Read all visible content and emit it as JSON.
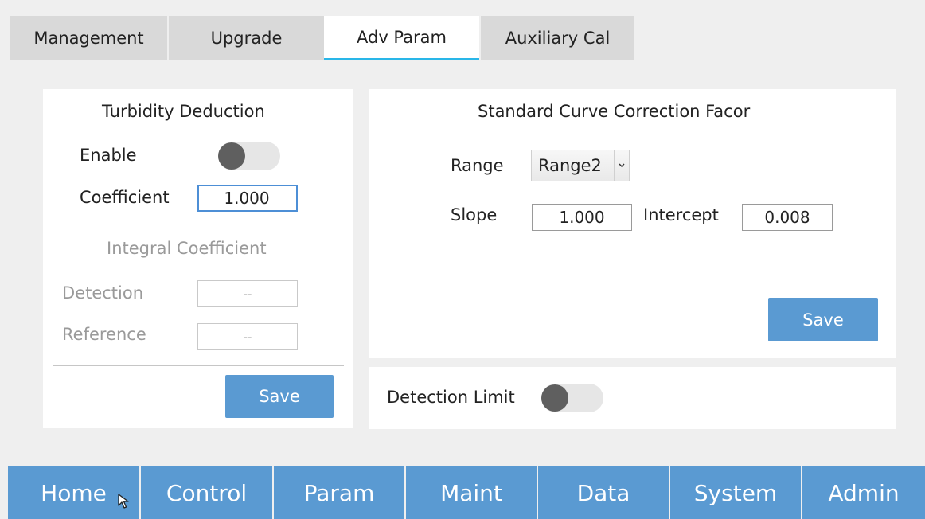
{
  "tabs": [
    {
      "label": "Management",
      "active": false
    },
    {
      "label": "Upgrade",
      "active": false
    },
    {
      "label": "Adv Param",
      "active": true
    },
    {
      "label": "Auxiliary Cal",
      "active": false
    }
  ],
  "turbidity": {
    "title": "Turbidity Deduction",
    "enable_label": "Enable",
    "enable_on": false,
    "coefficient_label": "Coefficient",
    "coefficient_value": "1.000",
    "integral_title": "Integral Coefficient",
    "detection_label": "Detection",
    "detection_value": "--",
    "reference_label": "Reference",
    "reference_value": "--",
    "save_label": "Save"
  },
  "standard_curve": {
    "title": "Standard Curve Correction Facor",
    "range_label": "Range",
    "range_value": "Range2",
    "slope_label": "Slope",
    "slope_value": "1.000",
    "intercept_label": "Intercept",
    "intercept_value": "0.008",
    "save_label": "Save"
  },
  "detection_limit": {
    "label": "Detection Limit",
    "on": false
  },
  "bottom_nav": [
    "Home",
    "Control",
    "Param",
    "Maint",
    "Data",
    "System",
    "Admin"
  ],
  "colors": {
    "accent_button": "#5a9ad2",
    "active_tab_underline": "#29b6e8",
    "toggle_knob": "#5f5f5f"
  }
}
